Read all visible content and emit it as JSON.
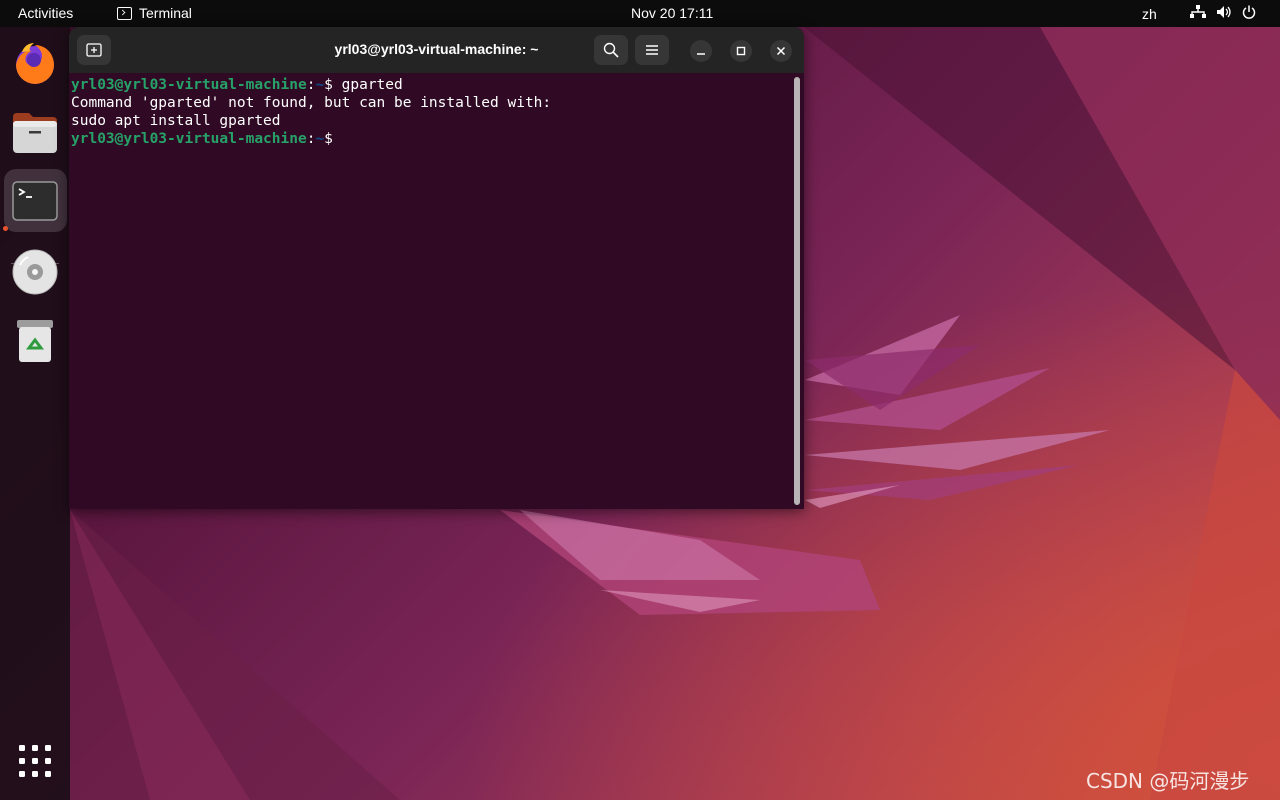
{
  "topbar": {
    "activities": "Activities",
    "app_name": "Terminal",
    "clock": "Nov 20  17:11",
    "input_language": "zh",
    "icons": [
      "network-wired-icon",
      "volume-icon",
      "power-icon"
    ]
  },
  "dock": {
    "items": [
      {
        "name": "Firefox",
        "icon": "firefox-icon",
        "running": false
      },
      {
        "name": "Files",
        "icon": "files-icon",
        "running": false
      },
      {
        "name": "Terminal",
        "icon": "terminal-icon",
        "running": true
      },
      {
        "name": "Disc",
        "icon": "optical-disc-icon",
        "running": false
      },
      {
        "name": "Trash",
        "icon": "trash-icon",
        "running": false
      },
      {
        "name": "Show Applications",
        "icon": "app-grid-icon",
        "running": false
      }
    ],
    "running_indicator_color": "#e9542c"
  },
  "terminal": {
    "title": "yrl03@yrl03-virtual-machine: ~",
    "prompt_user": "yrl03@yrl03-virtual-machine",
    "prompt_sep": ":",
    "prompt_path": "~",
    "prompt_symbol": "$",
    "lines": {
      "cmd1": " gparted",
      "out1": "Command 'gparted' not found, but can be installed with:",
      "out2": "sudo apt install gparted"
    },
    "colors": {
      "background": "#300a24",
      "prompt_user": "#26a269",
      "prompt_path": "#12488b",
      "text": "#ffffff"
    }
  },
  "watermark": "CSDN @码河漫步"
}
